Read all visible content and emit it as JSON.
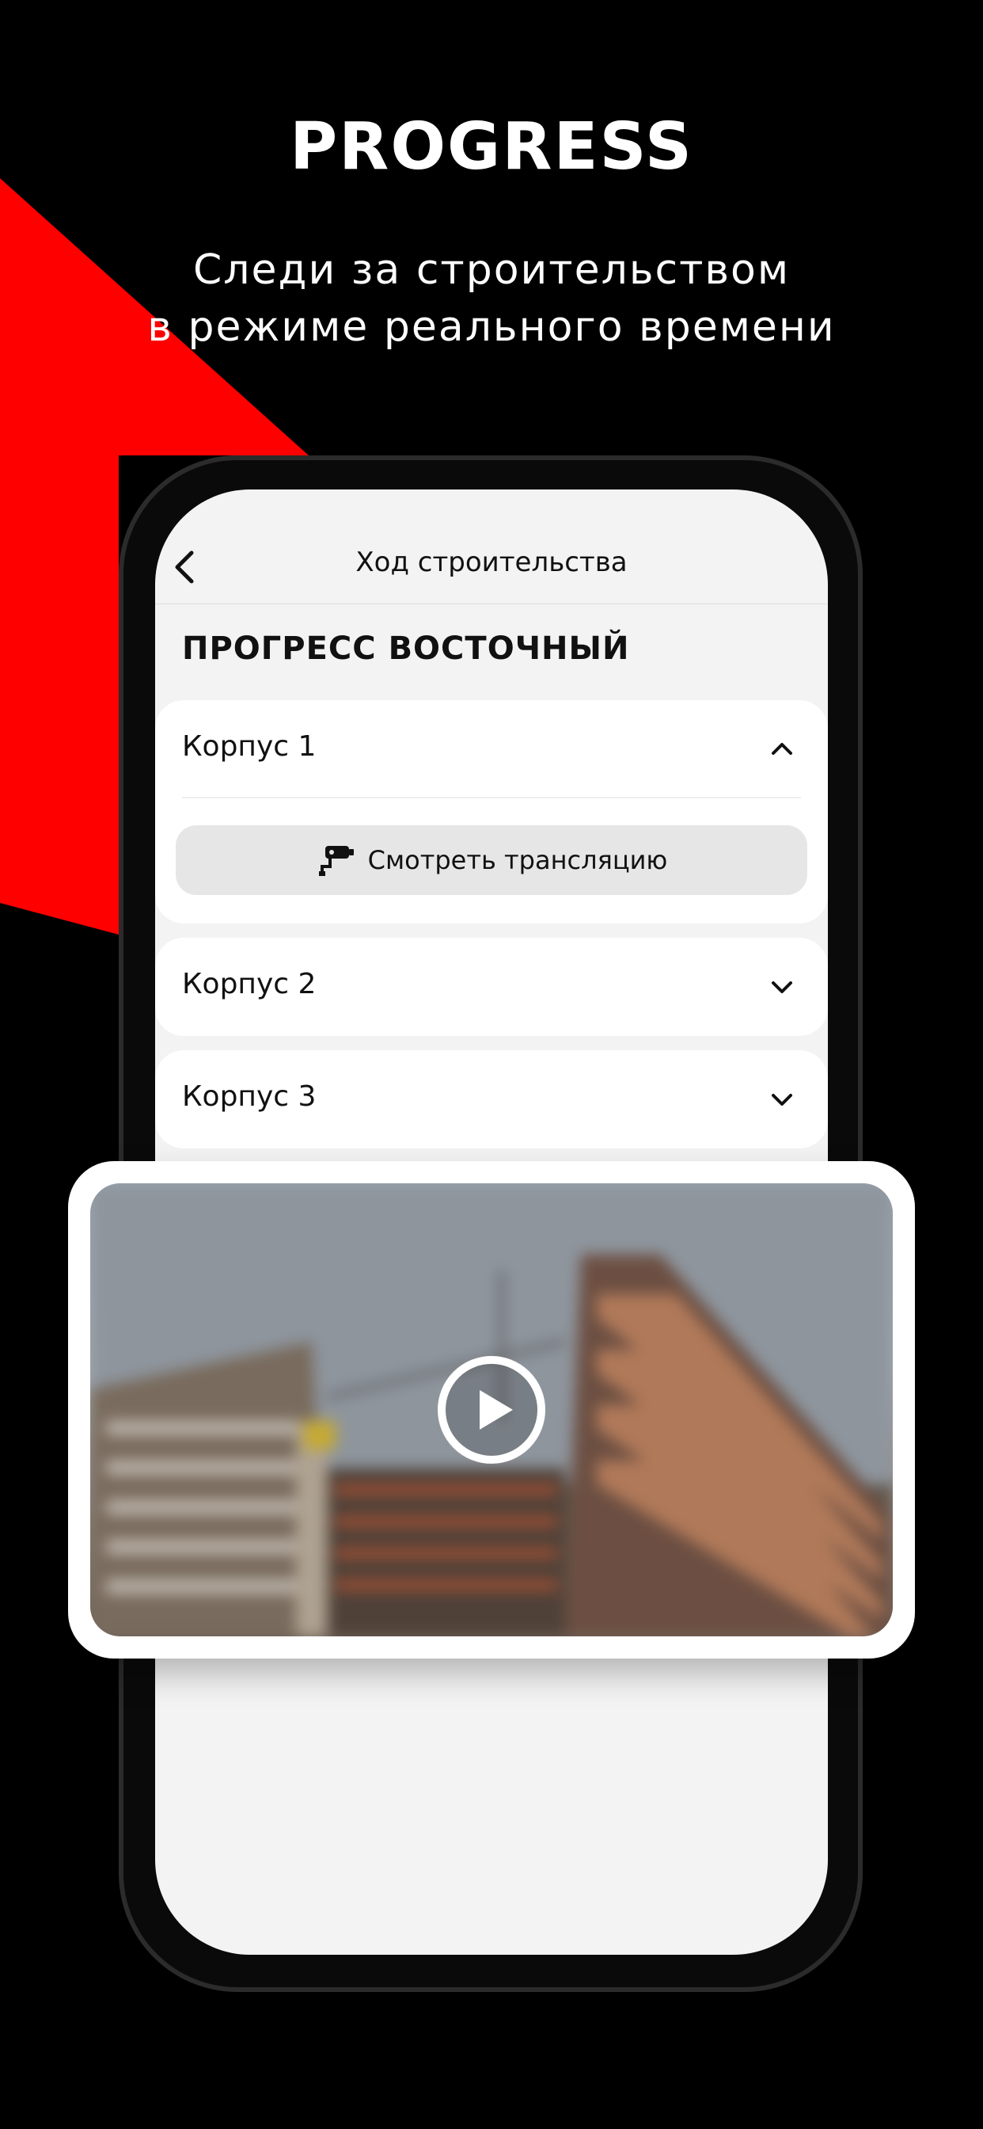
{
  "brand": {
    "logo_text": "PROGRESS",
    "accent_color": "#ff0000"
  },
  "tagline": {
    "line1": "Следи за строительством",
    "line2": "в режиме реального времени"
  },
  "app": {
    "nav_title": "Ход строительства",
    "project_title": "ПРОГРЕСС ВОСТОЧНЫЙ",
    "buildings": [
      {
        "label": "Корпус 1",
        "expanded": true,
        "action_label": "Смотреть трансляцию",
        "action_icon": "camera-icon"
      },
      {
        "label": "Корпус 2",
        "expanded": false
      },
      {
        "label": "Корпус 3",
        "expanded": false
      }
    ]
  },
  "video": {
    "play_icon": "play-icon"
  }
}
